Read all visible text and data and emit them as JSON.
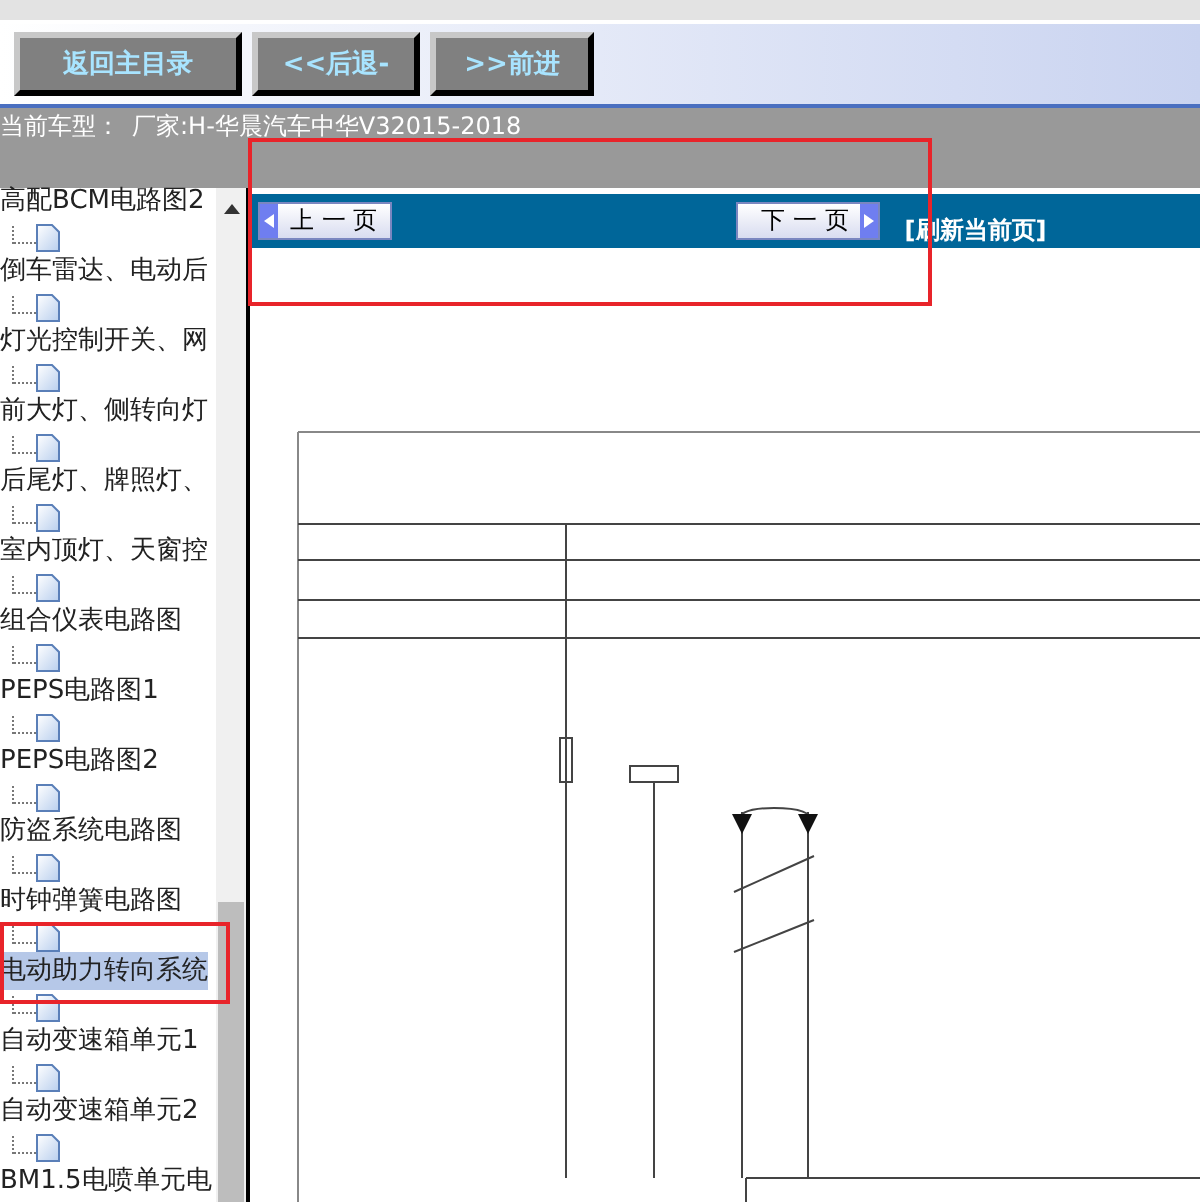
{
  "toolbar": {
    "buttons": [
      "返回主目录",
      "<<后退-",
      ">>前进"
    ]
  },
  "vehicle": {
    "label": "当前车型：",
    "value": "厂家:H-华晨汽车中华V32015-2018"
  },
  "sidebar": {
    "items": [
      {
        "label": "高配BCM电路图2",
        "selected": false
      },
      {
        "label": "倒车雷达、电动后",
        "selected": false
      },
      {
        "label": "灯光控制开关、网",
        "selected": false
      },
      {
        "label": "前大灯、侧转向灯",
        "selected": false
      },
      {
        "label": "后尾灯、牌照灯、",
        "selected": false
      },
      {
        "label": "室内顶灯、天窗控",
        "selected": false
      },
      {
        "label": "组合仪表电路图",
        "selected": false
      },
      {
        "label": "PEPS电路图1",
        "selected": false
      },
      {
        "label": "PEPS电路图2",
        "selected": false
      },
      {
        "label": "防盗系统电路图",
        "selected": false
      },
      {
        "label": "时钟弹簧电路图",
        "selected": false
      },
      {
        "label": "电动助力转向系统",
        "selected": true
      },
      {
        "label": "自动变速箱单元1",
        "selected": false
      },
      {
        "label": "自动变速箱单元2",
        "selected": false
      },
      {
        "label": "BM1.5电喷单元电",
        "selected": false
      }
    ]
  },
  "pager": {
    "previous": "上 一 页",
    "next": "下 一 页",
    "refresh": "[刷新当前页]"
  }
}
